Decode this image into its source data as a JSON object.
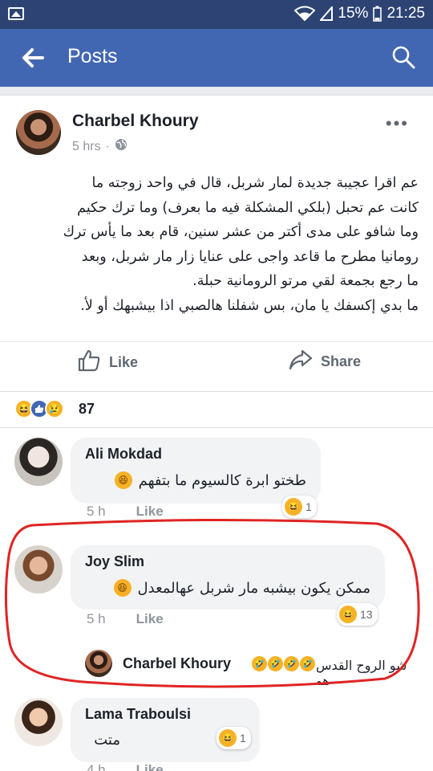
{
  "status_bar": {
    "battery": "15%",
    "time": "21:25"
  },
  "appbar": {
    "title": "Posts"
  },
  "post": {
    "author": "Charbel Khoury",
    "time": "5 hrs",
    "body_lines": [
      "عم اقرا عجيبة جديدة لمار شربل، قال في واحد زوجته ما",
      "كانت عم تحبل (بلكي المشكلة فيه ما بعرف) وما ترك حكيم",
      "وما شافو على مدى أكتر من عشر سنين، قام بعد ما يأس ترك",
      "رومانيا مطرح ما قاعد واجى على عنايا زار مار شربل، وبعد",
      "ما رجع بجمعة لقي مرتو الرومانية حبلة.",
      "ما بدي إكسفك يا مان، بس شفلنا هالصبي اذا بيشبهك أو لأ."
    ],
    "like_label": "Like",
    "share_label": "Share",
    "reaction_count": "87"
  },
  "comments": [
    {
      "name": "Ali Mokdad",
      "text": "طختو ابرة كالسيوم ما بتفهم",
      "time": "5 h",
      "like_label": "Like",
      "reactions": "1"
    },
    {
      "name": "Joy Slim",
      "text": "ممكن يكون بيشبه مار شربل عهالمعدل",
      "time": "5 h",
      "like_label": "Like",
      "reactions": "13",
      "reply": {
        "name": "Charbel Khoury",
        "text": "شو الروح القدس هو"
      }
    },
    {
      "name": "Lama Traboulsi",
      "text": "متت",
      "time": "4 h",
      "like_label": "Like",
      "reactions": "1"
    }
  ],
  "colors": {
    "brand": "#4267b2",
    "statusbar": "#2d4373",
    "annotation": "#e02424",
    "emoji": "#f7b125"
  },
  "icons": [
    "image-icon",
    "wifi-icon",
    "signal-icon",
    "battery-icon",
    "back-arrow-icon",
    "search-icon",
    "more-options-icon",
    "globe-icon",
    "like-icon",
    "share-icon",
    "haha-reaction-icon",
    "like-reaction-icon",
    "sad-reaction-icon"
  ]
}
